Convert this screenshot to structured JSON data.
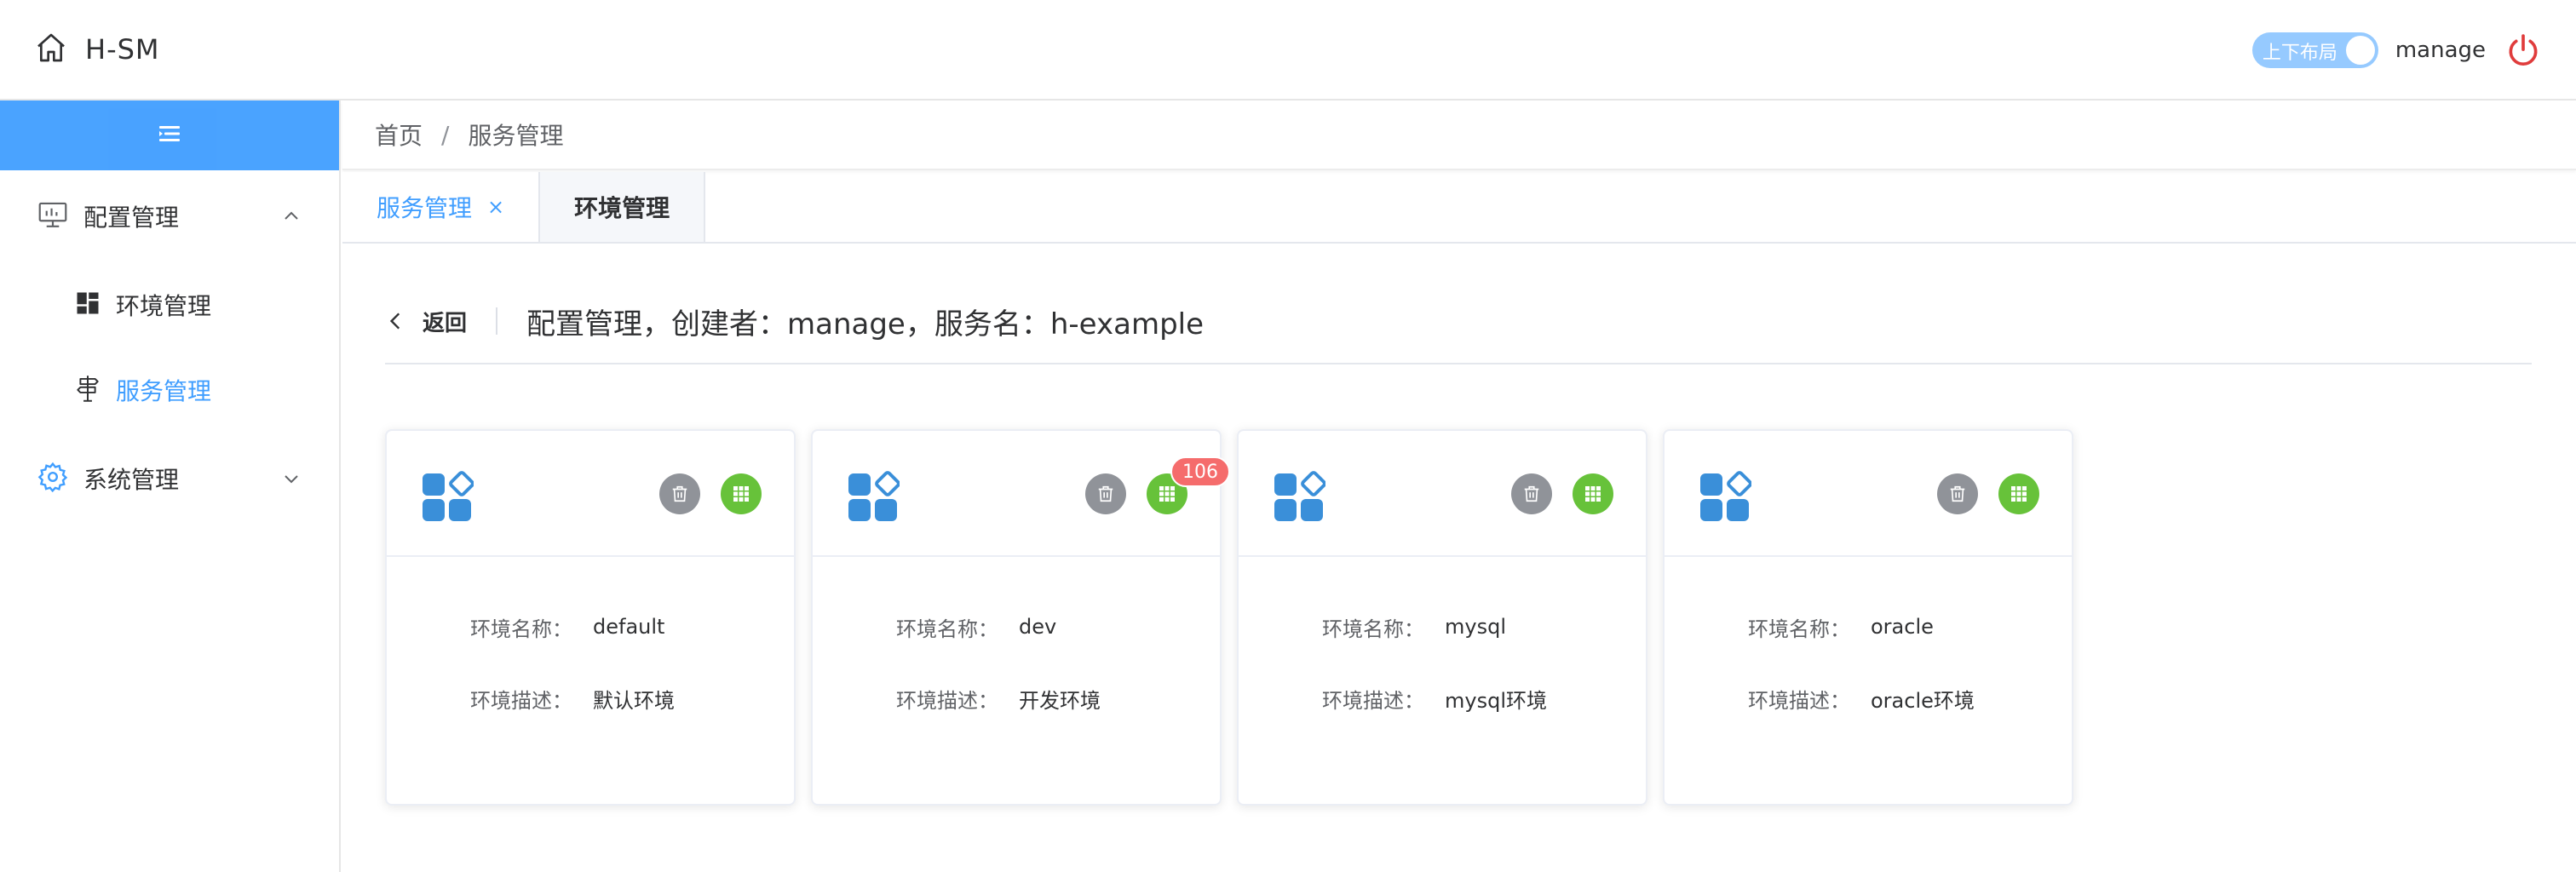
{
  "header": {
    "app_title": "H-SM",
    "layout_toggle_label": "上下布局",
    "username": "manage"
  },
  "sidebar": {
    "groups": [
      {
        "label": "配置管理",
        "expanded": true,
        "icon": "monitor-chart-icon",
        "items": [
          {
            "label": "环境管理",
            "icon": "dashboard-icon",
            "active": false
          },
          {
            "label": "服务管理",
            "icon": "signpost-icon",
            "active": true
          }
        ]
      },
      {
        "label": "系统管理",
        "expanded": false,
        "icon": "gear-icon"
      }
    ]
  },
  "breadcrumb": {
    "home": "首页",
    "separator": "/",
    "current": "服务管理"
  },
  "tabs": [
    {
      "label": "服务管理",
      "active": true,
      "close": "×"
    },
    {
      "label": "环境管理",
      "active": false
    }
  ],
  "page": {
    "back_label": "返回",
    "title": "配置管理，创建者：manage，服务名：h-example"
  },
  "env_cards": {
    "name_label": "环境名称：",
    "desc_label": "环境描述：",
    "items": [
      {
        "name": "default",
        "desc": "默认环境",
        "badge": ""
      },
      {
        "name": "dev",
        "desc": "开发环境",
        "badge": "106"
      },
      {
        "name": "mysql",
        "desc": "mysql环境",
        "badge": ""
      },
      {
        "name": "oracle",
        "desc": "oracle环境",
        "badge": ""
      }
    ]
  },
  "colors": {
    "primary": "#409eff",
    "success": "#67c23a",
    "info": "#909399",
    "danger": "#f56c6c",
    "logo_blue": "#3a8fd9"
  }
}
